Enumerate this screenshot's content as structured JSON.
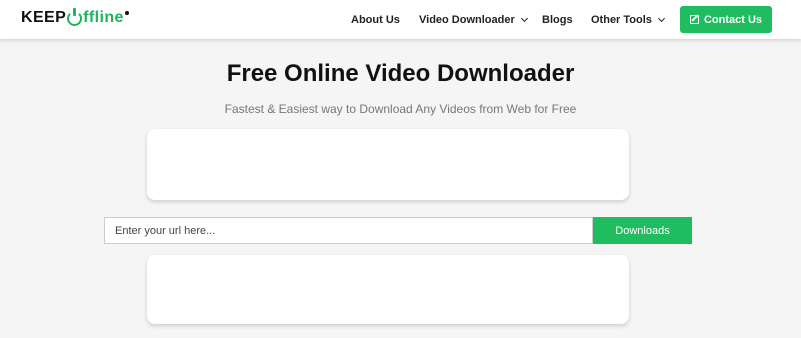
{
  "logo": {
    "part1": "KEEP",
    "part2": "ffline"
  },
  "nav": {
    "items": [
      {
        "label": "About Us",
        "has_dropdown": false
      },
      {
        "label": "Video Downloader",
        "has_dropdown": true
      },
      {
        "label": "Blogs",
        "has_dropdown": false
      },
      {
        "label": "Other Tools",
        "has_dropdown": true
      }
    ],
    "contact_label": "Contact Us",
    "contact_icon": "edit-icon"
  },
  "hero": {
    "title": "Free Online Video Downloader",
    "subtitle": "Fastest & Easiest way to Download Any Videos from Web for Free"
  },
  "search": {
    "value": "",
    "placeholder": "Enter your url here...",
    "button_label": "Downloads"
  },
  "colors": {
    "accent": "#1fbd5f",
    "background": "#f5f5f5"
  }
}
